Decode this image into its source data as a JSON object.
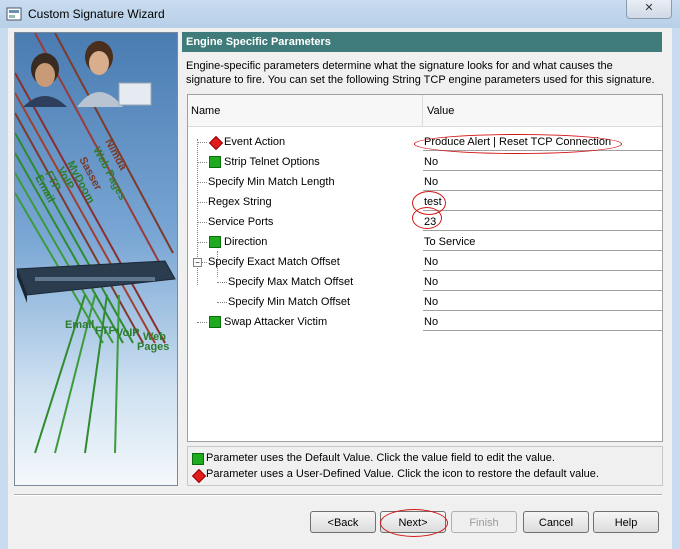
{
  "window": {
    "title": "Custom Signature Wizard",
    "close_label": "✕"
  },
  "graphic": {
    "diagonal_labels": [
      "Email",
      "FTP",
      "VoIP",
      "MyDoom",
      "Sasser",
      "Web Pages",
      "Nimda"
    ],
    "bottom_labels": [
      "Email",
      "FTP",
      "VoIP",
      "Web",
      "Pages"
    ]
  },
  "panel": {
    "header": "Engine Specific Parameters",
    "description": "Engine-specific parameters determine what the signature looks for and what causes the signature to fire. You can set the following String TCP engine parameters used for this signature."
  },
  "table": {
    "columns": [
      "Name",
      "Value"
    ],
    "rows": [
      {
        "name": "Event Action",
        "value": "Produce Alert | Reset TCP Connection",
        "icon": "red-diamond-icon"
      },
      {
        "name": "Strip Telnet Options",
        "value": "No",
        "icon": "green-square-icon"
      },
      {
        "name": "Specify Min Match Length",
        "value": "No",
        "icon": "none"
      },
      {
        "name": "Regex String",
        "value": "test",
        "icon": "none"
      },
      {
        "name": "Service Ports",
        "value": "23",
        "icon": "none"
      },
      {
        "name": "Direction",
        "value": "To Service",
        "icon": "green-square-icon"
      },
      {
        "name": "Specify Exact Match Offset",
        "value": "No",
        "icon": "collapse-icon"
      },
      {
        "name": "Specify Max Match Offset",
        "value": "No",
        "icon": "none"
      },
      {
        "name": "Specify Min Match Offset",
        "value": "No",
        "icon": "none"
      },
      {
        "name": "Swap Attacker Victim",
        "value": "No",
        "icon": "green-square-icon"
      }
    ]
  },
  "legend": {
    "default_text": "Parameter uses the Default Value.  Click the value field to edit the value.",
    "user_text": "Parameter uses a User-Defined Value.  Click the icon to restore the default value."
  },
  "buttons": {
    "back": "<Back",
    "next": "Next>",
    "finish": "Finish",
    "cancel": "Cancel",
    "help": "Help"
  },
  "colors": {
    "header_bg": "#3f7b7b",
    "default_icon": "#1faa1f",
    "user_icon": "#e21b1b",
    "annotation": "#d41616"
  }
}
